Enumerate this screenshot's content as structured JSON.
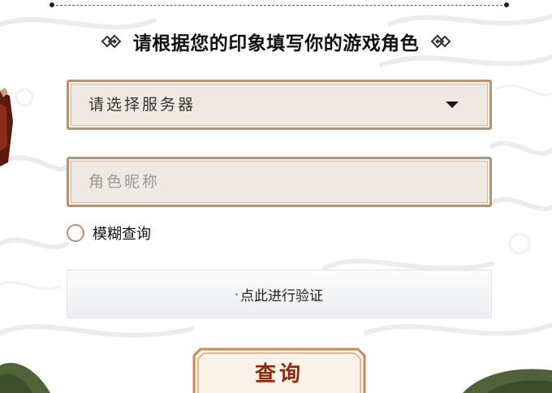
{
  "heading": {
    "title": "请根据您的印象填写你的游戏角色",
    "left_icon": "double-diamond-icon",
    "right_icon": "double-diamond-icon"
  },
  "server_select": {
    "placeholder": "请选择服务器",
    "icon": "caret-down-icon"
  },
  "nickname_input": {
    "placeholder": "角色昵称"
  },
  "fuzzy_search": {
    "label": "模糊查询",
    "checked": false
  },
  "verification": {
    "label": "点此进行验证"
  },
  "query_button": {
    "label": "查询"
  },
  "colors": {
    "field_border": "#b39379",
    "field_background": "#efe9e1",
    "button_text": "#8e2a10",
    "button_border": "#c98b56",
    "button_background": "#fbf3e8"
  }
}
